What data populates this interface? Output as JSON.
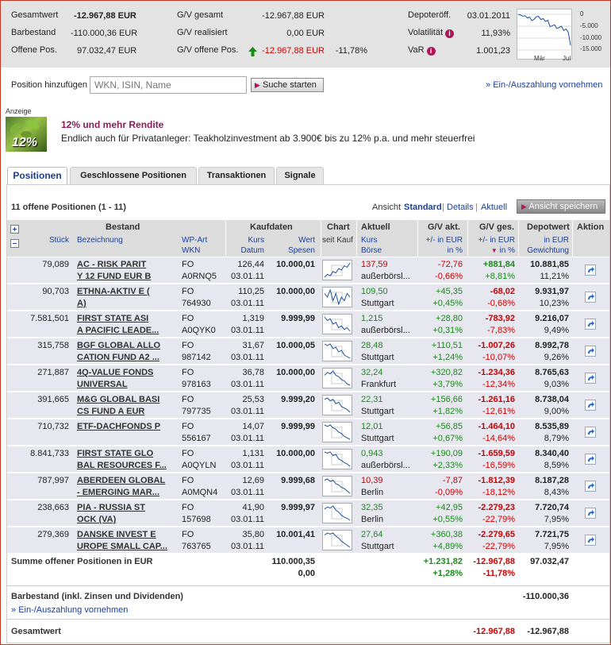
{
  "summary": {
    "gesamtwert_label": "Gesamtwert",
    "gesamtwert": "-12.967,88 EUR",
    "barbestand_label": "Barbestand",
    "barbestand": "-110.000,36 EUR",
    "offene_label": "Offene Pos.",
    "offene": "97.032,47 EUR",
    "gv_gesamt_label": "G/V gesamt",
    "gv_gesamt": "-12.967,88 EUR",
    "gv_real_label": "G/V realisiert",
    "gv_real": "0,00 EUR",
    "gv_offen_label": "G/V offene Pos.",
    "gv_offen": "-12.967,88 EUR",
    "gv_offen_pct": "-11,78%",
    "depot_label": "Depoteröff.",
    "depot": "03.01.2011",
    "vola_label": "Volatilität",
    "vola": "11,93%",
    "var_label": "VaR",
    "var": "1.001,23",
    "info_glyph": "i",
    "spark_labels": {
      "y0": "0",
      "y1": "-5.000",
      "y2": "-10.000",
      "y3": "-15.000",
      "x1": "Mär",
      "x2": "Jul"
    },
    "spark_series": [
      0,
      -300,
      -800,
      -600,
      -1500,
      -1200,
      -2600,
      -2100,
      -1000,
      -900,
      -2200,
      -1800,
      -3000,
      -2500,
      -5200,
      -4800,
      -4400,
      -6000,
      -5500,
      -5000,
      -6800,
      -6200,
      -7500,
      -12967
    ]
  },
  "add": {
    "label": "Position hinzufügen",
    "placeholder": "WKN, ISIN, Name",
    "search_btn": "Suche starten",
    "link": "Ein-/Auszahlung vornehmen"
  },
  "ad": {
    "tag": "Anzeige",
    "badge": "12%",
    "title": "12% und mehr Rendite",
    "text": "Endlich auch für Privatanleger: Teakholzinvestment ab 3.900€ bis zu 12% p.a. und mehr steuerfrei"
  },
  "tabs": [
    "Positionen",
    "Geschlossene Positionen",
    "Transaktionen",
    "Signale"
  ],
  "toolbar": {
    "count": "11 offene Positionen (1 - 11)",
    "ansicht": "Ansicht",
    "standard": "Standard",
    "details": "Details",
    "aktuell": "Aktuell",
    "save": "Ansicht speichern"
  },
  "head": {
    "bestand": "Bestand",
    "kaufdaten": "Kaufdaten",
    "chart": "Chart",
    "aktuell": "Aktuell",
    "gv_akt": "G/V akt.",
    "gv_ges": "G/V ges.",
    "depotwert": "Depotwert",
    "aktion": "Aktion",
    "stueck": "Stück",
    "bezeichnung": "Bezeichnung",
    "wpart": "WP-Art",
    "wkn": "WKN",
    "kurs": "Kurs",
    "datum": "Datum",
    "wert": "Wert",
    "spesen": "Spesen",
    "seit_kauf": "seit Kauf",
    "kurs2": "Kurs",
    "boerse": "Börse",
    "pm_eur": "+/- in EUR",
    "pm_pct": "in %",
    "pm_eur2": "+/- in EUR",
    "pm_pct2": "in %",
    "in_eur": "in EUR",
    "gewichtung": "Gewichtung"
  },
  "rows": [
    {
      "stueck": "79,089",
      "n1": "AC - RISK PARIT",
      "n2": "Y 12 FUND EUR B",
      "art": "FO",
      "wkn": "A0RNQ5",
      "kurs": "126,44",
      "datum": "03.01.11",
      "wert": "10.000,01",
      "spesen": "",
      "akurs": "137,59",
      "boerse": "außerbörsl...",
      "gva_eur": "-72,76",
      "gva_pct": "-0,66%",
      "gvg_eur": "+881,84",
      "gvg_pct": "+8,81%",
      "dw": "10.881,85",
      "gew": "11,21%",
      "ak": "r",
      "ap": "r",
      "ge": "g",
      "gp": "g",
      "spark": [
        10,
        12,
        11,
        14,
        13,
        16,
        15,
        18,
        17,
        20
      ]
    },
    {
      "stueck": "90,703",
      "n1": "ETHNA-AKTIV E (",
      "n2": "A)",
      "art": "FO",
      "wkn": "764930",
      "kurs": "110,25",
      "datum": "03.01.11",
      "wert": "10.000,00",
      "spesen": "",
      "akurs": "109,50",
      "boerse": "Stuttgart",
      "gva_eur": "+45,35",
      "gva_pct": "+0,45%",
      "gvg_eur": "-68,02",
      "gvg_pct": "-0,68%",
      "dw": "9.931,97",
      "gew": "10,23%",
      "ak": "g",
      "ap": "g",
      "ge": "r",
      "gp": "r",
      "spark": [
        14,
        13,
        15,
        12,
        14,
        11,
        13,
        12,
        14,
        13
      ]
    },
    {
      "stueck": "7.581,501",
      "n1": "FIRST STATE ASI",
      "n2": "A PACIFIC LEADE...",
      "art": "FO",
      "wkn": "A0QYK0",
      "kurs": "1,319",
      "datum": "03.01.11",
      "wert": "9.999,99",
      "spesen": "",
      "akurs": "1,215",
      "boerse": "außerbörsl...",
      "gva_eur": "+28,80",
      "gva_pct": "+0,31%",
      "gvg_eur": "-783,92",
      "gvg_pct": "-7,83%",
      "dw": "9.216,07",
      "gew": "9,49%",
      "ak": "g",
      "ap": "g",
      "ge": "r",
      "gp": "r",
      "spark": [
        18,
        16,
        17,
        14,
        15,
        12,
        13,
        11,
        12,
        10
      ]
    },
    {
      "stueck": "315,758",
      "n1": "BGF GLOBAL ALLO",
      "n2": "CATION FUND A2 ...",
      "art": "FO",
      "wkn": "987142",
      "kurs": "31,67",
      "datum": "03.01.11",
      "wert": "10.000,05",
      "spesen": "",
      "akurs": "28,48",
      "boerse": "Stuttgart",
      "gva_eur": "+110,51",
      "gva_pct": "+1,24%",
      "gvg_eur": "-1.007,26",
      "gvg_pct": "-10,07%",
      "dw": "8.992,78",
      "gew": "9,26%",
      "ak": "g",
      "ap": "g",
      "ge": "r",
      "gp": "r",
      "spark": [
        18,
        17,
        18,
        15,
        16,
        13,
        14,
        11,
        10,
        9
      ]
    },
    {
      "stueck": "271,887",
      "n1": "4Q-VALUE FONDS",
      "n2": "UNIVERSAL",
      "art": "FO",
      "wkn": "978163",
      "kurs": "36,78",
      "datum": "03.01.11",
      "wert": "10.000,00",
      "spesen": "",
      "akurs": "32,24",
      "boerse": "Frankfurt",
      "gva_eur": "+320,82",
      "gva_pct": "+3,79%",
      "gvg_eur": "-1.234,36",
      "gvg_pct": "-12,34%",
      "dw": "8.765,63",
      "gew": "9,03%",
      "ak": "g",
      "ap": "g",
      "ge": "r",
      "gp": "r",
      "spark": [
        16,
        18,
        17,
        19,
        16,
        15,
        13,
        12,
        10,
        9
      ]
    },
    {
      "stueck": "391,665",
      "n1": "M&G GLOBAL BASI",
      "n2": "CS FUND A EUR",
      "art": "FO",
      "wkn": "797735",
      "kurs": "25,53",
      "datum": "03.01.11",
      "wert": "9.999,20",
      "spesen": "",
      "akurs": "22,31",
      "boerse": "Stuttgart",
      "gva_eur": "+156,66",
      "gva_pct": "+1,82%",
      "gvg_eur": "-1.261,16",
      "gvg_pct": "-12,61%",
      "dw": "8.738,04",
      "gew": "9,00%",
      "ak": "g",
      "ap": "g",
      "ge": "r",
      "gp": "r",
      "spark": [
        17,
        18,
        16,
        17,
        14,
        15,
        12,
        11,
        10,
        8
      ]
    },
    {
      "stueck": "710,732",
      "n1": "ETF-DACHFONDS P",
      "n2": "",
      "art": "FO",
      "wkn": "556167",
      "kurs": "14,07",
      "datum": "03.01.11",
      "wert": "9.999,99",
      "spesen": "",
      "akurs": "12,01",
      "boerse": "Stuttgart",
      "gva_eur": "+56,85",
      "gva_pct": "+0,67%",
      "gvg_eur": "-1.464,10",
      "gvg_pct": "-14,64%",
      "dw": "8.535,89",
      "gew": "8,79%",
      "ak": "g",
      "ap": "g",
      "ge": "r",
      "gp": "r",
      "spark": [
        18,
        17,
        18,
        16,
        15,
        13,
        12,
        10,
        9,
        8
      ]
    },
    {
      "stueck": "8.841,733",
      "n1": "FIRST STATE GLO",
      "n2": "BAL RESOURCES F...",
      "art": "FO",
      "wkn": "A0QYLN",
      "kurs": "1,131",
      "datum": "03.01.11",
      "wert": "10.000,00",
      "spesen": "",
      "akurs": "0,943",
      "boerse": "außerbörsl...",
      "gva_eur": "+190,09",
      "gva_pct": "+2,33%",
      "gvg_eur": "-1.659,59",
      "gvg_pct": "-16,59%",
      "dw": "8.340,40",
      "gew": "8,59%",
      "ak": "g",
      "ap": "g",
      "ge": "r",
      "gp": "r",
      "spark": [
        19,
        18,
        19,
        16,
        17,
        13,
        12,
        10,
        9,
        7
      ]
    },
    {
      "stueck": "787,997",
      "n1": "ABERDEEN GLOBAL",
      "n2": "- EMERGING MAR...",
      "art": "FO",
      "wkn": "A0MQN4",
      "kurs": "12,69",
      "datum": "03.01.11",
      "wert": "9.999,68",
      "spesen": "",
      "akurs": "10,39",
      "boerse": "Berlin",
      "gva_eur": "-7,87",
      "gva_pct": "-0,09%",
      "gvg_eur": "-1.812,39",
      "gvg_pct": "-18,12%",
      "dw": "8.187,28",
      "gew": "8,43%",
      "ak": "r",
      "ap": "r",
      "ge": "r",
      "gp": "r",
      "spark": [
        18,
        19,
        17,
        18,
        15,
        14,
        12,
        11,
        9,
        7
      ]
    },
    {
      "stueck": "238,663",
      "n1": "PIA - RUSSIA ST",
      "n2": "OCK (VA)",
      "art": "FO",
      "wkn": "157698",
      "kurs": "41,90",
      "datum": "03.01.11",
      "wert": "9.999,97",
      "spesen": "",
      "akurs": "32,35",
      "boerse": "Berlin",
      "gva_eur": "+42,95",
      "gva_pct": "+0,55%",
      "gvg_eur": "-2.279,23",
      "gvg_pct": "-22,79%",
      "dw": "7.720,74",
      "gew": "7,95%",
      "ak": "g",
      "ap": "g",
      "ge": "r",
      "gp": "r",
      "spark": [
        17,
        19,
        18,
        20,
        16,
        14,
        11,
        9,
        8,
        6
      ]
    },
    {
      "stueck": "279,369",
      "n1": "DANSKE INVEST E",
      "n2": "UROPE SMALL CAP...",
      "art": "FO",
      "wkn": "763765",
      "kurs": "35,80",
      "datum": "03.01.11",
      "wert": "10.001,41",
      "spesen": "",
      "akurs": "27,64",
      "boerse": "Stuttgart",
      "gva_eur": "+360,38",
      "gva_pct": "+4,89%",
      "gvg_eur": "-2.279,65",
      "gvg_pct": "-22,79%",
      "dw": "7.721,75",
      "gew": "7,95%",
      "ak": "g",
      "ap": "g",
      "ge": "r",
      "gp": "r",
      "spark": [
        18,
        20,
        19,
        20,
        17,
        15,
        12,
        10,
        8,
        6
      ]
    }
  ],
  "totals": {
    "summe_label": "Summe offener Positionen in EUR",
    "summe_wert": "110.000,35",
    "summe_spesen": "0,00",
    "summe_gva": "+1.231,82",
    "summe_gva_pct": "+1,28%",
    "summe_gvg": "-12.967,88",
    "summe_gvg_pct": "-11,78%",
    "summe_dw": "97.032,47",
    "bar_label": "Barbestand (inkl. Zinsen und Dividenden)",
    "bar_dw": "-110.000,36",
    "bar_link": "Ein-/Auszahlung vornehmen",
    "ges_label": "Gesamtwert",
    "ges_gvg": "-12.967,88",
    "ges_dw": "-12.967,88"
  }
}
